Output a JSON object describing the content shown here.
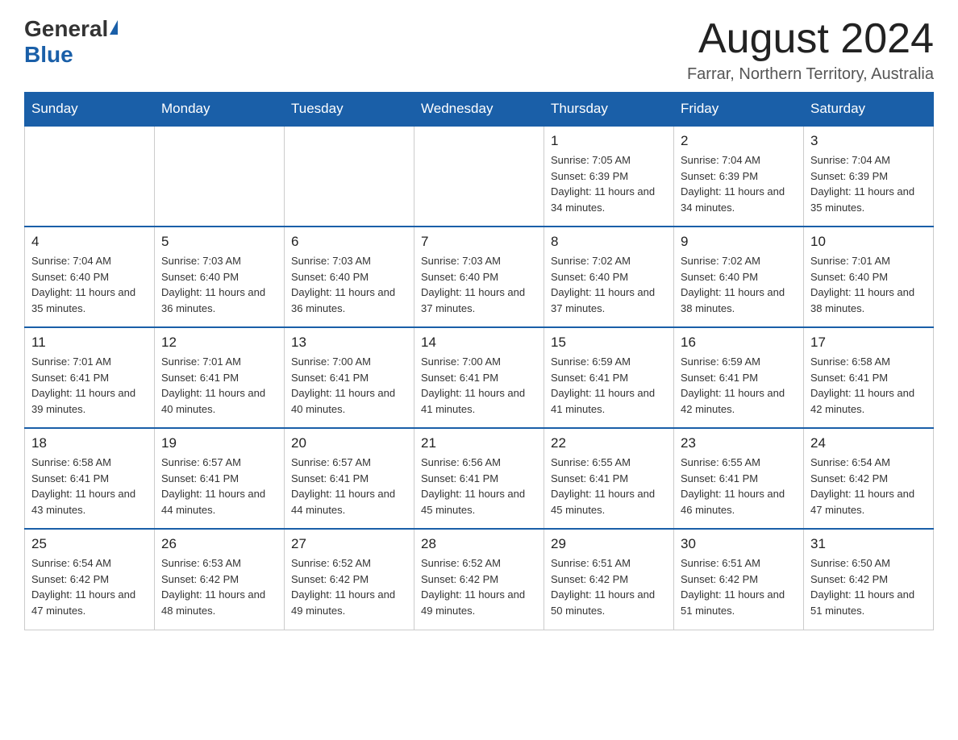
{
  "logo": {
    "general": "General",
    "blue": "Blue"
  },
  "header": {
    "month_title": "August 2024",
    "location": "Farrar, Northern Territory, Australia"
  },
  "days_of_week": [
    "Sunday",
    "Monday",
    "Tuesday",
    "Wednesday",
    "Thursday",
    "Friday",
    "Saturday"
  ],
  "weeks": [
    [
      {
        "day": "",
        "info": ""
      },
      {
        "day": "",
        "info": ""
      },
      {
        "day": "",
        "info": ""
      },
      {
        "day": "",
        "info": ""
      },
      {
        "day": "1",
        "info": "Sunrise: 7:05 AM\nSunset: 6:39 PM\nDaylight: 11 hours and 34 minutes."
      },
      {
        "day": "2",
        "info": "Sunrise: 7:04 AM\nSunset: 6:39 PM\nDaylight: 11 hours and 34 minutes."
      },
      {
        "day": "3",
        "info": "Sunrise: 7:04 AM\nSunset: 6:39 PM\nDaylight: 11 hours and 35 minutes."
      }
    ],
    [
      {
        "day": "4",
        "info": "Sunrise: 7:04 AM\nSunset: 6:40 PM\nDaylight: 11 hours and 35 minutes."
      },
      {
        "day": "5",
        "info": "Sunrise: 7:03 AM\nSunset: 6:40 PM\nDaylight: 11 hours and 36 minutes."
      },
      {
        "day": "6",
        "info": "Sunrise: 7:03 AM\nSunset: 6:40 PM\nDaylight: 11 hours and 36 minutes."
      },
      {
        "day": "7",
        "info": "Sunrise: 7:03 AM\nSunset: 6:40 PM\nDaylight: 11 hours and 37 minutes."
      },
      {
        "day": "8",
        "info": "Sunrise: 7:02 AM\nSunset: 6:40 PM\nDaylight: 11 hours and 37 minutes."
      },
      {
        "day": "9",
        "info": "Sunrise: 7:02 AM\nSunset: 6:40 PM\nDaylight: 11 hours and 38 minutes."
      },
      {
        "day": "10",
        "info": "Sunrise: 7:01 AM\nSunset: 6:40 PM\nDaylight: 11 hours and 38 minutes."
      }
    ],
    [
      {
        "day": "11",
        "info": "Sunrise: 7:01 AM\nSunset: 6:41 PM\nDaylight: 11 hours and 39 minutes."
      },
      {
        "day": "12",
        "info": "Sunrise: 7:01 AM\nSunset: 6:41 PM\nDaylight: 11 hours and 40 minutes."
      },
      {
        "day": "13",
        "info": "Sunrise: 7:00 AM\nSunset: 6:41 PM\nDaylight: 11 hours and 40 minutes."
      },
      {
        "day": "14",
        "info": "Sunrise: 7:00 AM\nSunset: 6:41 PM\nDaylight: 11 hours and 41 minutes."
      },
      {
        "day": "15",
        "info": "Sunrise: 6:59 AM\nSunset: 6:41 PM\nDaylight: 11 hours and 41 minutes."
      },
      {
        "day": "16",
        "info": "Sunrise: 6:59 AM\nSunset: 6:41 PM\nDaylight: 11 hours and 42 minutes."
      },
      {
        "day": "17",
        "info": "Sunrise: 6:58 AM\nSunset: 6:41 PM\nDaylight: 11 hours and 42 minutes."
      }
    ],
    [
      {
        "day": "18",
        "info": "Sunrise: 6:58 AM\nSunset: 6:41 PM\nDaylight: 11 hours and 43 minutes."
      },
      {
        "day": "19",
        "info": "Sunrise: 6:57 AM\nSunset: 6:41 PM\nDaylight: 11 hours and 44 minutes."
      },
      {
        "day": "20",
        "info": "Sunrise: 6:57 AM\nSunset: 6:41 PM\nDaylight: 11 hours and 44 minutes."
      },
      {
        "day": "21",
        "info": "Sunrise: 6:56 AM\nSunset: 6:41 PM\nDaylight: 11 hours and 45 minutes."
      },
      {
        "day": "22",
        "info": "Sunrise: 6:55 AM\nSunset: 6:41 PM\nDaylight: 11 hours and 45 minutes."
      },
      {
        "day": "23",
        "info": "Sunrise: 6:55 AM\nSunset: 6:41 PM\nDaylight: 11 hours and 46 minutes."
      },
      {
        "day": "24",
        "info": "Sunrise: 6:54 AM\nSunset: 6:42 PM\nDaylight: 11 hours and 47 minutes."
      }
    ],
    [
      {
        "day": "25",
        "info": "Sunrise: 6:54 AM\nSunset: 6:42 PM\nDaylight: 11 hours and 47 minutes."
      },
      {
        "day": "26",
        "info": "Sunrise: 6:53 AM\nSunset: 6:42 PM\nDaylight: 11 hours and 48 minutes."
      },
      {
        "day": "27",
        "info": "Sunrise: 6:52 AM\nSunset: 6:42 PM\nDaylight: 11 hours and 49 minutes."
      },
      {
        "day": "28",
        "info": "Sunrise: 6:52 AM\nSunset: 6:42 PM\nDaylight: 11 hours and 49 minutes."
      },
      {
        "day": "29",
        "info": "Sunrise: 6:51 AM\nSunset: 6:42 PM\nDaylight: 11 hours and 50 minutes."
      },
      {
        "day": "30",
        "info": "Sunrise: 6:51 AM\nSunset: 6:42 PM\nDaylight: 11 hours and 51 minutes."
      },
      {
        "day": "31",
        "info": "Sunrise: 6:50 AM\nSunset: 6:42 PM\nDaylight: 11 hours and 51 minutes."
      }
    ]
  ]
}
